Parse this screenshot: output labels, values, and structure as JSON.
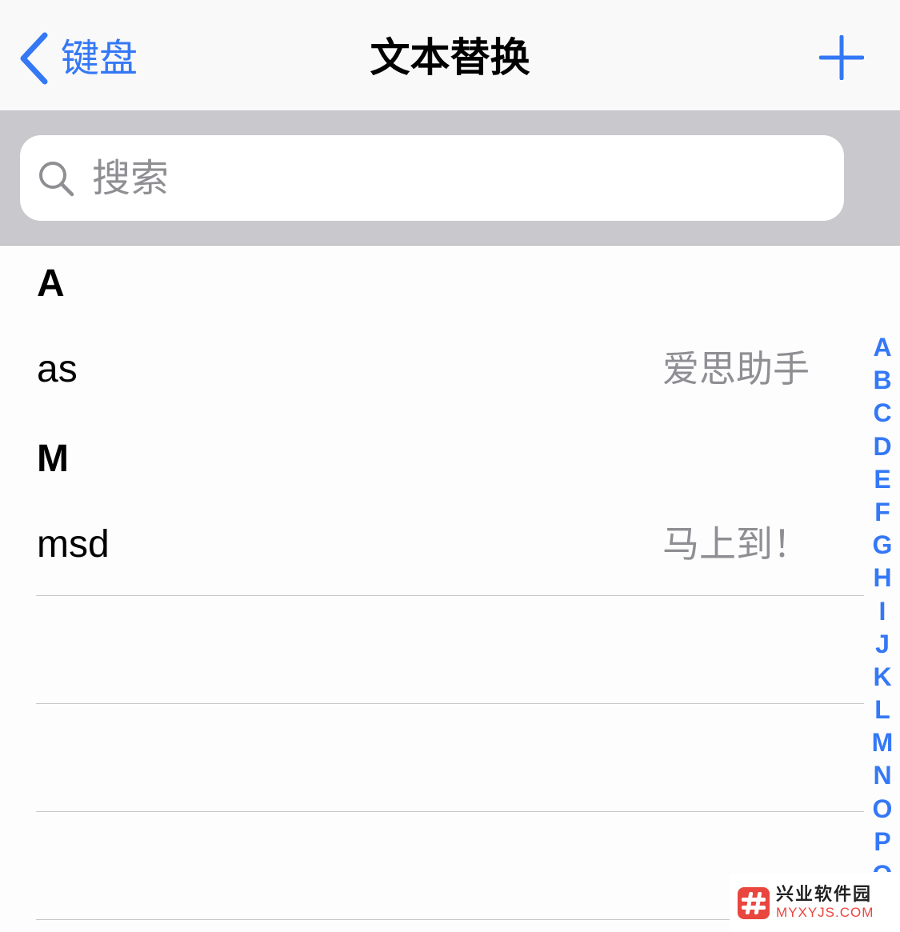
{
  "nav": {
    "back_label": "键盘",
    "title": "文本替换"
  },
  "search": {
    "placeholder": "搜索"
  },
  "sections": [
    {
      "header": "A",
      "rows": [
        {
          "phrase": "as",
          "shortcut": "爱思助手"
        }
      ]
    },
    {
      "header": "M",
      "rows": [
        {
          "phrase": "msd",
          "shortcut": "马上到！"
        }
      ]
    }
  ],
  "index": [
    "A",
    "B",
    "C",
    "D",
    "E",
    "F",
    "G",
    "H",
    "I",
    "J",
    "K",
    "L",
    "M",
    "N",
    "O",
    "P",
    "Q"
  ],
  "watermark": {
    "title": "兴业软件园",
    "url": "MYXYJS.COM"
  },
  "colors": {
    "accent": "#3478f6",
    "secondary_text": "#8e8e93",
    "search_bg": "#c8c8cd"
  }
}
